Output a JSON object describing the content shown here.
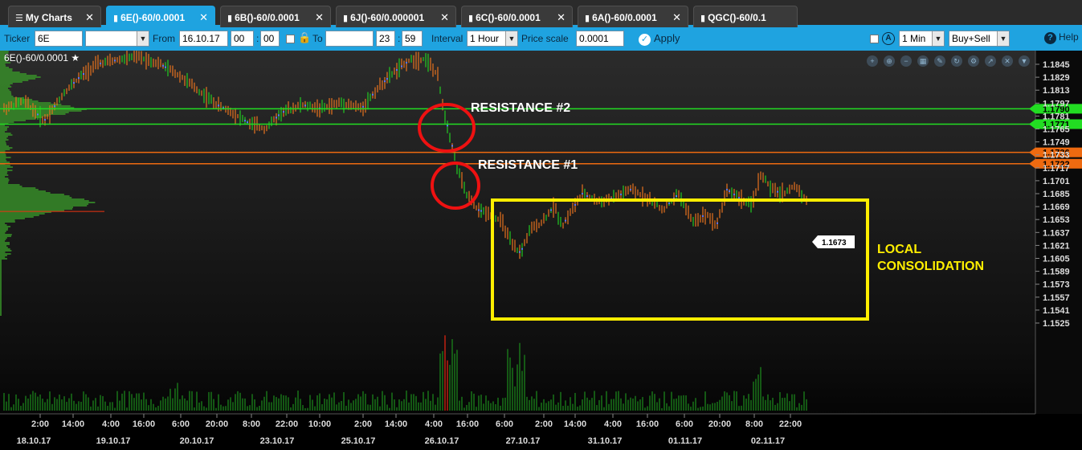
{
  "tabs": [
    {
      "label": "My Charts",
      "icon": "menu-icon"
    },
    {
      "label": "6E()-60/0.0001",
      "icon": "bar-chart-icon",
      "active": true
    },
    {
      "label": "6B()-60/0.0001",
      "icon": "bar-chart-icon"
    },
    {
      "label": "6J()-60/0.000001",
      "icon": "bar-chart-icon"
    },
    {
      "label": "6C()-60/0.0001",
      "icon": "bar-chart-icon"
    },
    {
      "label": "6A()-60/0.0001",
      "icon": "bar-chart-icon"
    },
    {
      "label": "QGC()-60/0.1",
      "icon": "bar-chart-icon"
    }
  ],
  "toolbar": {
    "ticker_label": "Ticker",
    "ticker_value": "6E",
    "from_label": "From",
    "from_date": "16.10.17",
    "from_hour": "00",
    "from_min": "00",
    "to_label": "To",
    "to_date": "",
    "to_hour": "23",
    "to_min": "59",
    "interval_label": "Interval",
    "interval_value": "1 Hour",
    "price_scale_label": "Price scale",
    "price_scale_value": "0.0001",
    "apply_label": "Apply",
    "tick_value": "1 Min",
    "side_value": "Buy+Sell",
    "help_label": "Help",
    "help_icon": "question-icon",
    "lock_icon": "lock-icon",
    "auto_icon": "a-circle-icon"
  },
  "chart": {
    "title": "6E()-60/0.0001",
    "price_ticks": [
      "1.1845",
      "1.1829",
      "1.1813",
      "1.1797",
      "1.1781",
      "1.1765",
      "1.1749",
      "1.1733",
      "1.1717",
      "1.1701",
      "1.1685",
      "1.1669",
      "1.1653",
      "1.1637",
      "1.1621",
      "1.1605",
      "1.1589",
      "1.1573",
      "1.1557",
      "1.1541",
      "1.1525"
    ],
    "time_ticks": [
      "2:00",
      "14:00",
      "4:00",
      "16:00",
      "6:00",
      "20:00",
      "8:00",
      "22:00",
      "10:00",
      "2:00",
      "14:00",
      "4:00",
      "16:00",
      "6:00",
      "2:00",
      "14:00",
      "4:00",
      "16:00",
      "6:00",
      "20:00",
      "8:00",
      "22:00"
    ],
    "date_ticks": [
      "18.10.17",
      "19.10.17",
      "20.10.17",
      "23.10.17",
      "25.10.17",
      "26.10.17",
      "27.10.17",
      "31.10.17",
      "01.11.17",
      "02.11.17"
    ],
    "levels": [
      {
        "price": "1.1790",
        "color": "#22dd22"
      },
      {
        "price": "1.1771",
        "color": "#22dd22"
      },
      {
        "price": "1.1736",
        "color": "#ee6a10"
      },
      {
        "price": "1.1722",
        "color": "#ee6a10"
      }
    ],
    "last_price": "1.1673",
    "annotations": {
      "resistance2": "RESISTANCE #2",
      "resistance1": "RESISTANCE #1",
      "consolidation_line1": "LOCAL",
      "consolidation_line2": "CONSOLIDATION"
    },
    "colors": {
      "up": "#22cc22",
      "down": "#e8731e",
      "annotation_box": "#ffee00",
      "circle": "#ee1111",
      "accent": "#1fa3e0"
    }
  }
}
